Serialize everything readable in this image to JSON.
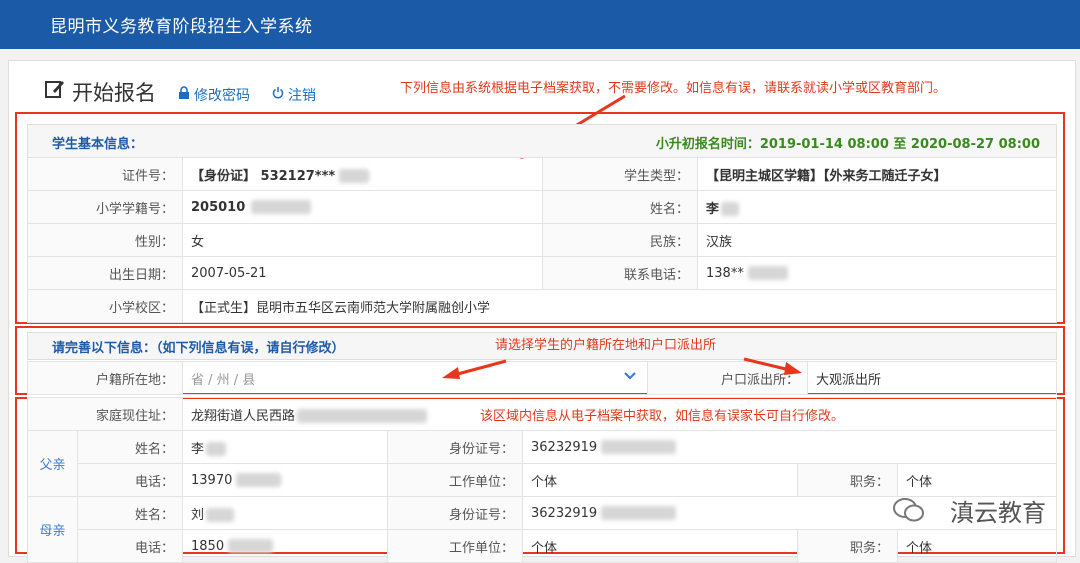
{
  "app": {
    "title": "昆明市义务教育阶段招生入学系统"
  },
  "header": {
    "page_title": "开始报名",
    "change_password": "修改密码",
    "logout": "注销",
    "notice": "下列信息由系统根据电子档案获取，不需要修改。如信息有误，请联系就读小学或区教育部门。"
  },
  "basic": {
    "section_label": "学生基本信息：",
    "reg_time": "小升初报名时间：2019-01-14 08:00 至 2020-08-27 08:00",
    "id_label": "证件号：",
    "id_value": "【身份证】 532127***",
    "type_label": "学生类型：",
    "type_value": "【昆明主城区学籍】【外来务工随迁子女】",
    "school_no_label": "小学学籍号：",
    "school_no_value": "205010",
    "name_label": "姓名：",
    "name_value": "李",
    "gender_label": "性别：",
    "gender_value": "女",
    "ethnic_label": "民族：",
    "ethnic_value": "汉族",
    "birth_label": "出生日期：",
    "birth_value": "2007-05-21",
    "phone_label": "联系电话：",
    "phone_value": "138**",
    "campus_label": "小学校区：",
    "campus_value": "【正式生】昆明市五华区云南师范大学附属融创小学"
  },
  "complete": {
    "section_label": "请完善以下信息：（如下列信息有误，请自行修改）",
    "annot": "请选择学生的户籍所在地和户口派出所",
    "hukou_label": "户籍所在地：",
    "hukou_placeholder": "省 / 州 / 县",
    "police_label": "户口派出所：",
    "police_value": "大观派出所"
  },
  "family": {
    "annot": "该区域内信息从电子档案中获取，如信息有误家长可自行修改。",
    "address_label": "家庭现住址：",
    "address_value": "龙翔街道人民西路",
    "father_side": "父亲",
    "mother_side": "母亲",
    "name_label": "姓名：",
    "id_label": "身份证号：",
    "phone_label": "电话：",
    "work_label": "工作单位：",
    "job_label": "职务：",
    "father": {
      "name": "李",
      "id": "36232919",
      "phone": "13970",
      "work": "个体",
      "job": "个体"
    },
    "mother": {
      "name": "刘",
      "id": "36232919",
      "phone": "1850",
      "work": "个体",
      "job": "个体"
    }
  },
  "watermark": "滇云教育",
  "colors": {
    "topbar": "#1b5aa6",
    "annotation": "#e03a1e",
    "accent": "#1e5aa8",
    "time": "#3a8a1f"
  }
}
